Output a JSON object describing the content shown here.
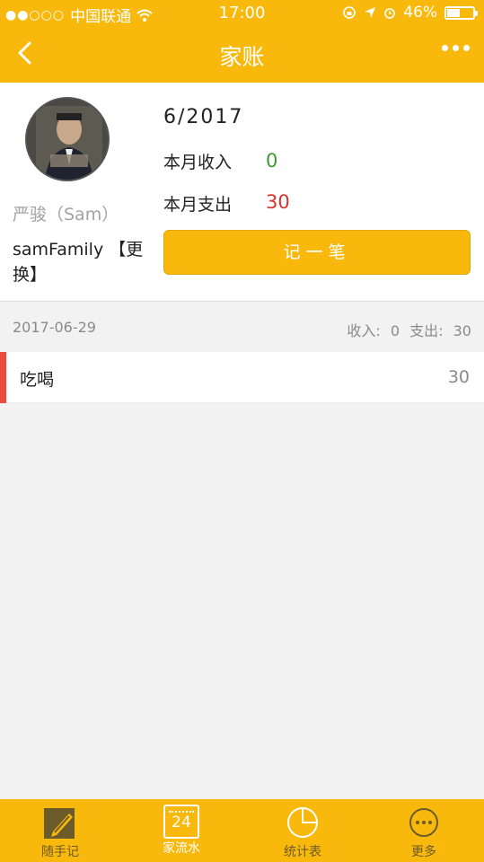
{
  "status_bar": {
    "carrier": "中国联通",
    "time": "17:00",
    "battery": "46%"
  },
  "nav": {
    "title": "家账"
  },
  "profile": {
    "name": "严骏（Sam）",
    "family": "samFamily 【更换】"
  },
  "summary": {
    "month": "6/2017",
    "income_label": "本月收入",
    "income_value": "0",
    "expense_label": "本月支出",
    "expense_value": "30",
    "record_button": "记一笔"
  },
  "day_group": {
    "date": "2017-06-29",
    "summary": "收入: 0 支出: 30",
    "items": [
      {
        "category": "吃喝",
        "amount": "30"
      }
    ]
  },
  "tabbar": {
    "tabs": [
      {
        "label": "随手记",
        "icon": "pencil-note-icon"
      },
      {
        "label": "家流水",
        "icon": "calendar-24-icon",
        "icon_text": "24"
      },
      {
        "label": "统计表",
        "icon": "chart-icon"
      },
      {
        "label": "更多",
        "icon": "more-icon"
      }
    ]
  },
  "colors": {
    "accent": "#f8b90c",
    "income": "#3f9a34",
    "expense": "#d9342b",
    "item_bar": "#e94b3c"
  }
}
